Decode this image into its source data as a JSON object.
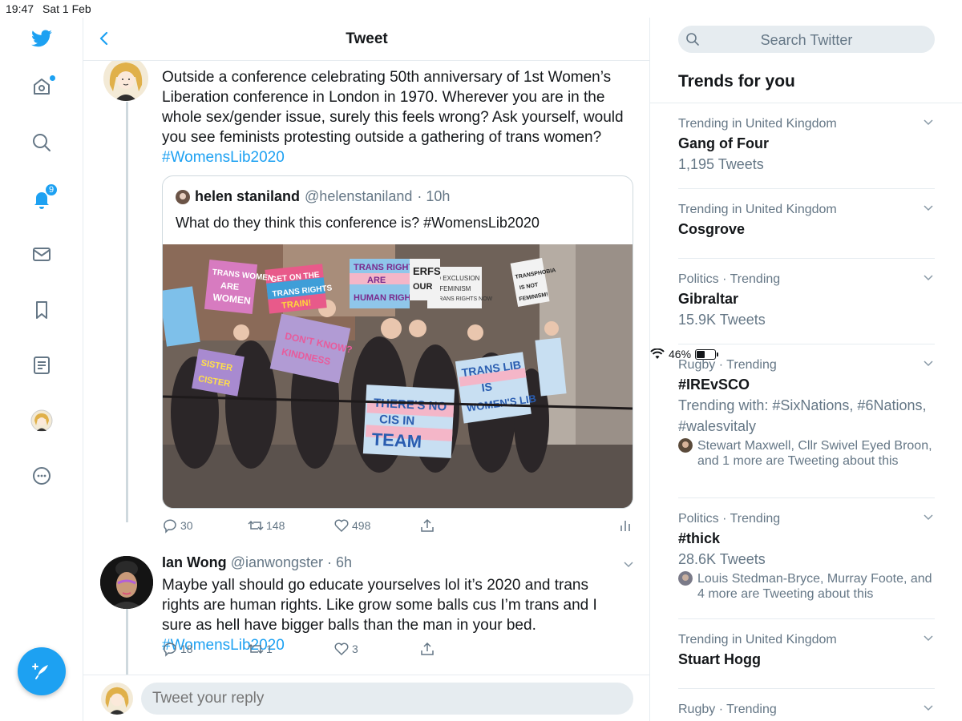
{
  "status_bar": {
    "time": "19:47",
    "date": "Sat 1 Feb",
    "battery": "46%",
    "battery_level": 0.46
  },
  "nav": {
    "notifications_badge": "9"
  },
  "header": {
    "title": "Tweet"
  },
  "main_tweet": {
    "text": "Outside a conference celebrating 50th anniversary of 1st Women’s Liberation conference in London in 1970. Wherever you are in the whole sex/gender issue, surely this feels wrong? Ask yourself, would you see feminists protesting outside a gathering of trans women?",
    "hashtag": "#WomensLib2020",
    "quote": {
      "name": "helen staniland",
      "handle": "@helenstaniland",
      "time": "· 10h",
      "text": "What do they think this conference is? #WomensLib2020",
      "signs": [
        "TRANS RIGHTS ARE HUMAN RIGHTS",
        "THERE'S NO CIS IN TEAM",
        "TRANS LIB IS WOMEN'S LIB",
        "DON'T KNOW? SHOW KINDNESS",
        "TRANS WOMEN ARE WOMEN",
        "GET ON THE TRANS RIGHTS TRAIN!",
        "TRANSPHOBIA IS NOT FEMINISM!",
        "NO EXCLUSION IN FEMINISM",
        "TERFS OUR",
        "SISTER NOT CISTER"
      ]
    },
    "actions": {
      "replies": "30",
      "retweets": "148",
      "likes": "498"
    }
  },
  "reply_tweet": {
    "name": "Ian Wong",
    "handle": "@ianwongster",
    "time": "· 6h",
    "text": "Maybe yall should go educate yourselves lol it’s 2020 and trans rights are human rights. Like grow some balls cus I’m trans and I sure as hell have bigger balls than the man in your bed.",
    "hashtag": "#WomensLib2020",
    "actions": {
      "replies": "18",
      "retweets": "1",
      "likes": "3"
    }
  },
  "reply_box": {
    "placeholder": "Tweet your reply"
  },
  "search": {
    "placeholder": "Search Twitter"
  },
  "trends": {
    "title": "Trends for you",
    "items": [
      {
        "context": "Trending in United Kingdom",
        "name": "Gang of Four",
        "count": "1,195 Tweets"
      },
      {
        "context": "Trending in United Kingdom",
        "name": "Cosgrove"
      },
      {
        "context": "Politics · Trending",
        "name": "Gibraltar",
        "count": "15.9K Tweets"
      },
      {
        "context": "Rugby · Trending",
        "name": "#IREvSCO",
        "count": "Trending with: #SixNations, #6Nations, #walesvitaly",
        "who": "Stewart Maxwell, Cllr Swivel Eyed Broon, and 1 more are Tweeting about this"
      },
      {
        "context": "Politics · Trending",
        "name": "#thick",
        "count": "28.6K Tweets",
        "who": "Louis Stedman-Bryce, Murray Foote, and 4 more are Tweeting about this"
      },
      {
        "context": "Trending in United Kingdom",
        "name": "Stuart Hogg"
      },
      {
        "context": "Rugby · Trending"
      }
    ]
  },
  "colors": {
    "accent": "#1da1f2",
    "text": "#14171a",
    "muted": "#657786",
    "border": "#e6ecf0"
  }
}
